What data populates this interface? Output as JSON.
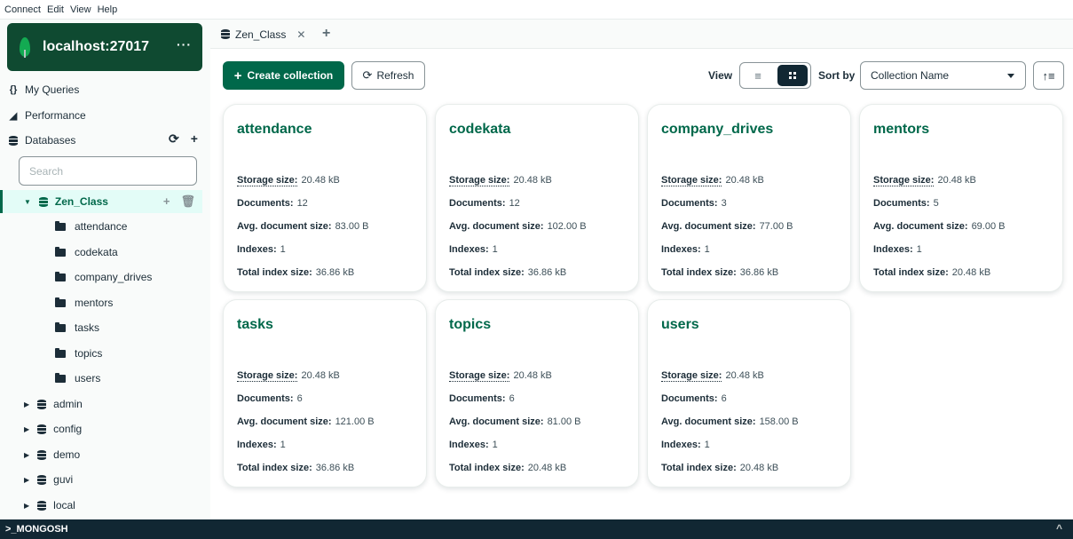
{
  "menubar": {
    "items": [
      "Connect",
      "Edit",
      "View",
      "Help"
    ]
  },
  "sidebar": {
    "connection_name": "localhost:27017",
    "more_label": "···",
    "nav": [
      {
        "icon": "{}",
        "label": "My Queries"
      },
      {
        "icon": "◢",
        "label": "Performance"
      },
      {
        "icon": "",
        "label": "Databases"
      }
    ],
    "db_refresh_icon": "⟳",
    "db_add_icon": "+",
    "search_placeholder": "Search",
    "active_db": "Zen_Class",
    "collections": [
      "attendance",
      "codekata",
      "company_drives",
      "mentors",
      "tasks",
      "topics",
      "users"
    ],
    "other_dbs": [
      "admin",
      "config",
      "demo",
      "guvi",
      "local"
    ]
  },
  "tabs": [
    {
      "label": "Zen_Class",
      "close": "✕"
    }
  ],
  "tab_add": "+",
  "toolbar": {
    "create_label": "Create collection",
    "create_icon": "+",
    "refresh_label": "Refresh",
    "refresh_icon": "⟳",
    "view_label": "View",
    "view_list_icon": "≡",
    "sort_label": "Sort by",
    "sort_value": "Collection Name",
    "sort_dir_icon": "↑≡"
  },
  "stat_labels": {
    "storage": "Storage size:",
    "documents": "Documents:",
    "avg": "Avg. document size:",
    "indexes": "Indexes:",
    "total_index": "Total index size:"
  },
  "cards": [
    {
      "name": "attendance",
      "storage": "20.48 kB",
      "documents": "12",
      "avg": "83.00 B",
      "indexes": "1",
      "total_index": "36.86 kB"
    },
    {
      "name": "codekata",
      "storage": "20.48 kB",
      "documents": "12",
      "avg": "102.00 B",
      "indexes": "1",
      "total_index": "36.86 kB"
    },
    {
      "name": "company_drives",
      "storage": "20.48 kB",
      "documents": "3",
      "avg": "77.00 B",
      "indexes": "1",
      "total_index": "36.86 kB"
    },
    {
      "name": "mentors",
      "storage": "20.48 kB",
      "documents": "5",
      "avg": "69.00 B",
      "indexes": "1",
      "total_index": "20.48 kB"
    },
    {
      "name": "tasks",
      "storage": "20.48 kB",
      "documents": "6",
      "avg": "121.00 B",
      "indexes": "1",
      "total_index": "36.86 kB"
    },
    {
      "name": "topics",
      "storage": "20.48 kB",
      "documents": "6",
      "avg": "81.00 B",
      "indexes": "1",
      "total_index": "20.48 kB"
    },
    {
      "name": "users",
      "storage": "20.48 kB",
      "documents": "6",
      "avg": "158.00 B",
      "indexes": "1",
      "total_index": "20.48 kB"
    }
  ],
  "shell": {
    "label": ">_MONGOSH",
    "toggle_icon": "^"
  },
  "colors": {
    "brand_dark": "#0f4a31",
    "accent": "#00684a",
    "leaf": "#13aa52",
    "shell_bg": "#112733"
  }
}
